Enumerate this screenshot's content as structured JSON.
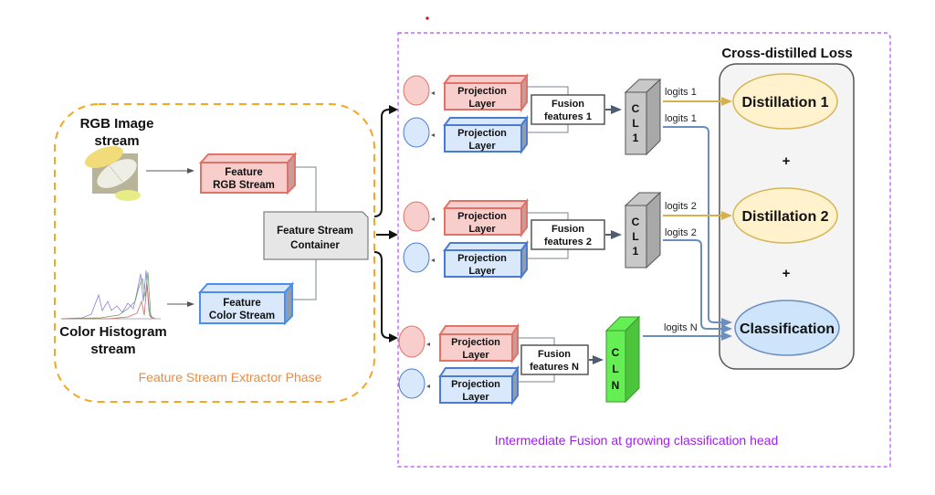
{
  "extractor": {
    "phase_label": "Feature Stream Extractor Phase",
    "rgb_title_1": "RGB Image",
    "rgb_title_2": "stream",
    "hist_title_1": "Color Histogram",
    "hist_title_2": "stream",
    "feature_rgb_1": "Feature",
    "feature_rgb_2": "RGB Stream",
    "feature_color_1": "Feature",
    "feature_color_2": "Color Stream",
    "container_1": "Feature Stream",
    "container_2": "Container"
  },
  "fusion": {
    "region_label": "Intermediate Fusion at growing classification head",
    "projection_1": "Projection",
    "projection_2": "Layer",
    "heads": [
      {
        "fusion_1": "Fusion",
        "fusion_2": "features 1",
        "cl": [
          "C",
          "L",
          "1"
        ],
        "logits_top": "logits 1",
        "logits_bottom": "logits 1"
      },
      {
        "fusion_1": "Fusion",
        "fusion_2": "features 2",
        "cl": [
          "C",
          "L",
          "1"
        ],
        "logits_top": "logits 2",
        "logits_bottom": "logits 2"
      },
      {
        "fusion_1": "Fusion",
        "fusion_2": "features N",
        "cl": [
          "C",
          "L",
          "N"
        ],
        "logits": "logits N"
      }
    ]
  },
  "loss": {
    "title": "Cross-distilled Loss",
    "distillation_1": "Distillation 1",
    "distillation_2": "Distillation 2",
    "plus": "+",
    "classification": "Classification"
  },
  "colors": {
    "extractor_border": "#f5a623",
    "extractor_label": "#f08a3a",
    "fusion_border": "#b44cf0",
    "fusion_label": "#a020f0",
    "red_fill": "#f8cecc",
    "red_stroke": "#e07268",
    "blue_fill": "#dae8fc",
    "blue_stroke": "#4a7bd1",
    "gray_head": "#c8c8c8",
    "green_head": "#66ee55",
    "distill_fill": "#fff2cc",
    "distill_stroke": "#d6b656",
    "class_fill": "#cde4fb",
    "gold_arrow": "#d6b04e",
    "blue_arrow": "#6c8ebf"
  }
}
